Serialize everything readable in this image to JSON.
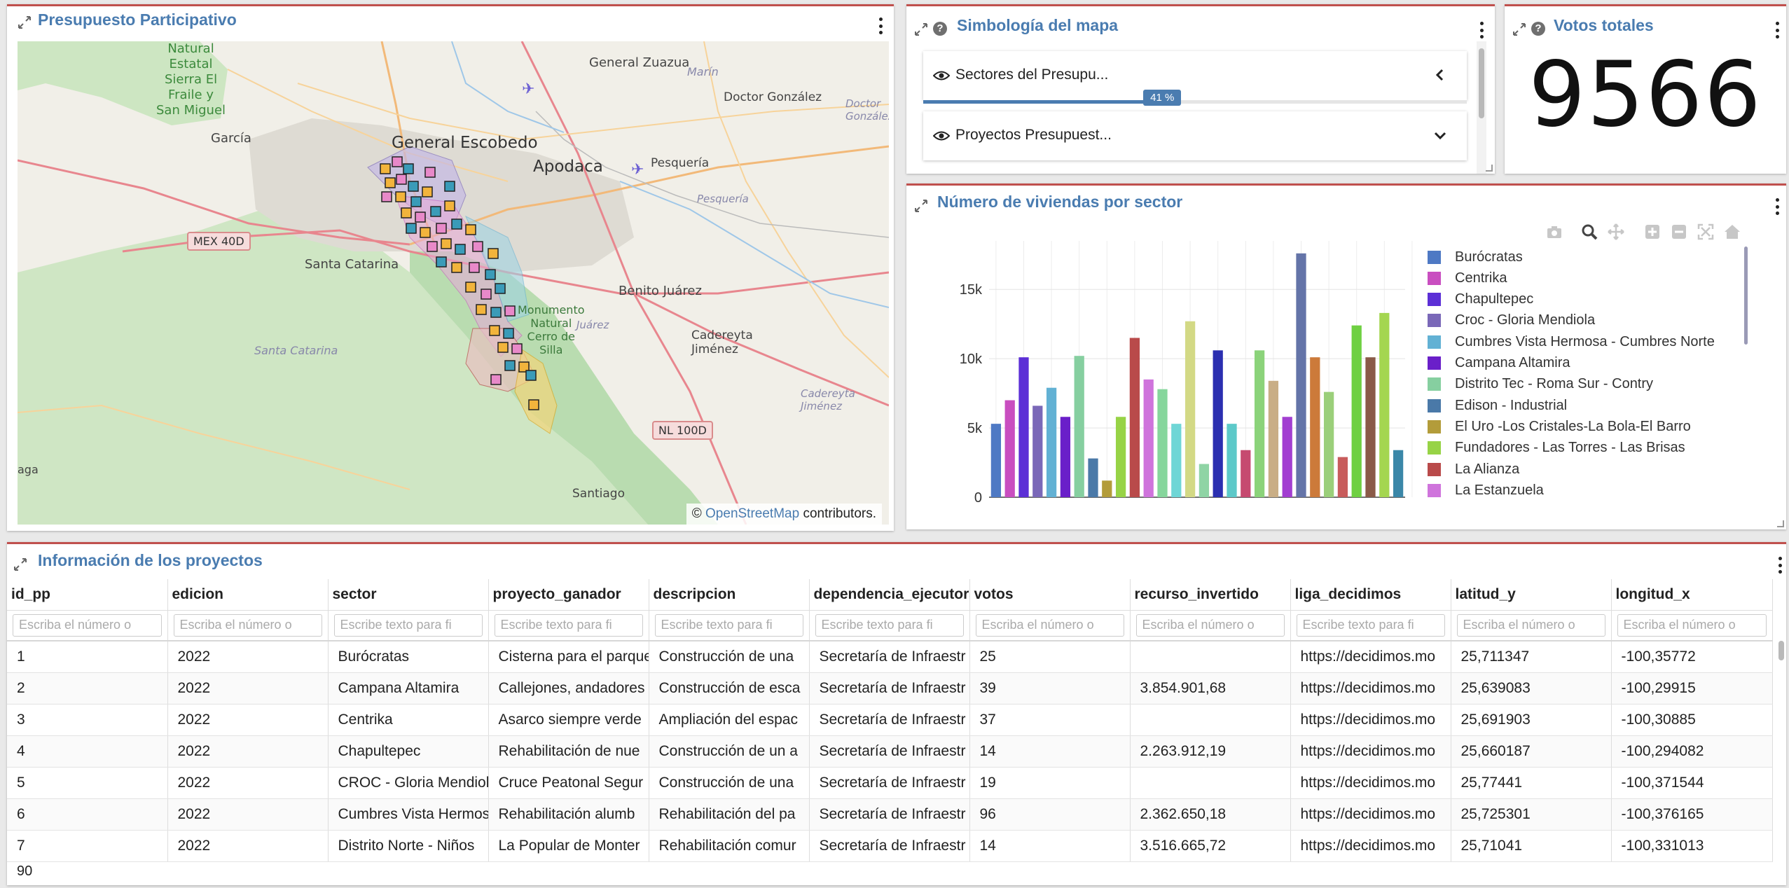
{
  "map_panel": {
    "title": "Presupuesto Participativo",
    "labels": {
      "natural_park": "Natural\nEstatal\nSierra El\nFraile y\nSan Miguel",
      "general_zuazua": "General Zuazua",
      "marin": "Marín",
      "doctor_gonzalez": "Doctor González",
      "doctor_gonzalez_it": "Doctor\nGonzález",
      "garcia": "García",
      "general_escobedo": "General Escobedo",
      "apodaca": "Apodaca",
      "pesqueria": "Pesquería",
      "pesqueria_it": "Pesquería",
      "santa_catarina": "Santa Catarina",
      "santa_catarina_it": "Santa Catarina",
      "benito_juarez": "Benito Juárez",
      "juarez_it": "Juárez",
      "cadereyta": "Cadereyta\nJiménez",
      "cadereyta_it": "Cadereyta\nJiménez",
      "monumento": "Monumento\nNatural\nCerro de\nSilla",
      "santiago": "Santiago",
      "aga": "aga",
      "mex40d": "MEX 40D",
      "nl100d": "NL 100D",
      "attrib_prefix": "© ",
      "attrib_link": "OpenStreetMap",
      "attrib_suffix": " contributors."
    }
  },
  "legend_panel": {
    "title": "Simbología del mapa",
    "help": "?",
    "layer1": "Sectores del Presupu...",
    "layer2": "Proyectos Presupuest...",
    "progress": "41 %",
    "progress_value": 0.41
  },
  "votes_panel": {
    "title": "Votos totales",
    "help": "?",
    "value": "9566"
  },
  "chart_panel": {
    "title": "Número de viviendas por sector"
  },
  "chart_data": {
    "type": "bar",
    "title": "Número de viviendas por sector",
    "xlabel": "",
    "ylabel": "",
    "ylim": [
      0,
      18500
    ],
    "yticks": [
      0,
      5000,
      10000,
      15000
    ],
    "ytick_labels": [
      "0",
      "5k",
      "10k",
      "15k"
    ],
    "grid": true,
    "legend": "right",
    "legend_entries": [
      {
        "name": "Burócratas",
        "color": "#4e79c4"
      },
      {
        "name": "Centrika",
        "color": "#c94ec0"
      },
      {
        "name": "Chapultepec",
        "color": "#5c2fd6"
      },
      {
        "name": "Croc - Gloria Mendiola",
        "color": "#7a68b8"
      },
      {
        "name": "Cumbres Vista Hermosa - Cumbres Norte",
        "color": "#62b1d4"
      },
      {
        "name": "Campana Altamira",
        "color": "#6a1fc9"
      },
      {
        "name": "Distrito Tec - Roma Sur - Contry",
        "color": "#86cfa0"
      },
      {
        "name": "Edison - Industrial",
        "color": "#4a79a8"
      },
      {
        "name": "El Uro -Los Cristales-La Bola-El Barro",
        "color": "#b39c3a"
      },
      {
        "name": "Fundadores - Las Torres - Las Brisas",
        "color": "#97d346"
      },
      {
        "name": "La Alianza",
        "color": "#b94a4a"
      },
      {
        "name": "La Estanzuela",
        "color": "#cf74dc"
      }
    ],
    "values": [
      5300,
      7000,
      10100,
      6600,
      7900,
      5800,
      10200,
      2800,
      1200,
      5800,
      11500,
      8500,
      7800,
      5300,
      12700,
      2400,
      10600,
      5300,
      3400,
      10600,
      8400,
      5800,
      17600,
      10100,
      7600,
      2900,
      12400,
      10100,
      13300,
      3400
    ],
    "colors": [
      "#4e79c4",
      "#c94ec0",
      "#5c2fd6",
      "#7a68b8",
      "#62b1d4",
      "#6a1fc9",
      "#86cfa0",
      "#4a79a8",
      "#b39c3a",
      "#97d346",
      "#b94a4a",
      "#cf74dc",
      "#86d69c",
      "#6fd6d6",
      "#d3d985",
      "#8fd4a5",
      "#2b2fb0",
      "#5cc9c9",
      "#c64a70",
      "#8bd37a",
      "#c9ae86",
      "#a23ed1",
      "#6474a8",
      "#cc7a3a",
      "#9bcf7a",
      "#c85c5c",
      "#6fd042",
      "#8a5a48",
      "#a4d650",
      "#3b87a8"
    ]
  },
  "table_panel": {
    "title": "Información de los proyectos",
    "columns": [
      "id_pp",
      "edicion",
      "sector",
      "proyecto_ganador",
      "descripcion",
      "dependencia_ejecutora",
      "votos",
      "recurso_invertido",
      "liga_decidimos",
      "latitud_y",
      "longitud_x"
    ],
    "filters": [
      "Escriba el número o",
      "Escriba el número o",
      "Escribe texto para fi",
      "Escribe texto para fi",
      "Escribe texto para fi",
      "Escribe texto para fi",
      "Escriba el número o",
      "Escriba el número o",
      "Escribe texto para fi",
      "Escriba el número o",
      "Escriba el número o"
    ],
    "rows": [
      [
        "1",
        "2022",
        "Burócratas",
        "Cisterna para el parque",
        "Construcción de una",
        "Secretaría de Infraestr",
        "25",
        "",
        "https://decidimos.mo",
        "25,711347",
        "-100,35772"
      ],
      [
        "2",
        "2022",
        "Campana Altamira",
        "Callejones, andadores",
        "Construcción de esca",
        "Secretaría de Infraestr",
        "39",
        "3.854.901,68",
        "https://decidimos.mo",
        "25,639083",
        "-100,29915"
      ],
      [
        "3",
        "2022",
        "Centrika",
        "Asarco siempre verde",
        "Ampliación del espac",
        "Secretaría de Infraestr",
        "37",
        "",
        "https://decidimos.mo",
        "25,691903",
        "-100,30885"
      ],
      [
        "4",
        "2022",
        "Chapultepec",
        "Rehabilitación de nue",
        "Construcción de un a",
        "Secretaría de Infraestr",
        "14",
        "2.263.912,19",
        "https://decidimos.mo",
        "25,660187",
        "-100,294082"
      ],
      [
        "5",
        "2022",
        "CROC - Gloria Mendiola",
        "Cruce Peatonal Segur",
        "Construcción de una",
        "Secretaría de Infraestr",
        "19",
        "",
        "https://decidimos.mo",
        "25,77441",
        "-100,371544"
      ],
      [
        "6",
        "2022",
        "Cumbres Vista Hermosa",
        "Rehabilitación alumb",
        "Rehabilitación del pa",
        "Secretaría de Infraestr",
        "96",
        "2.362.650,18",
        "https://decidimos.mo",
        "25,725301",
        "-100,376165"
      ],
      [
        "7",
        "2022",
        "Distrito Norte - Niños",
        "La Popular de Monter",
        "Rehabilitación comur",
        "Secretaría de Infraestr",
        "14",
        "3.516.665,72",
        "https://decidimos.mo",
        "25,71041",
        "-100,331013"
      ]
    ],
    "footer": "90"
  }
}
